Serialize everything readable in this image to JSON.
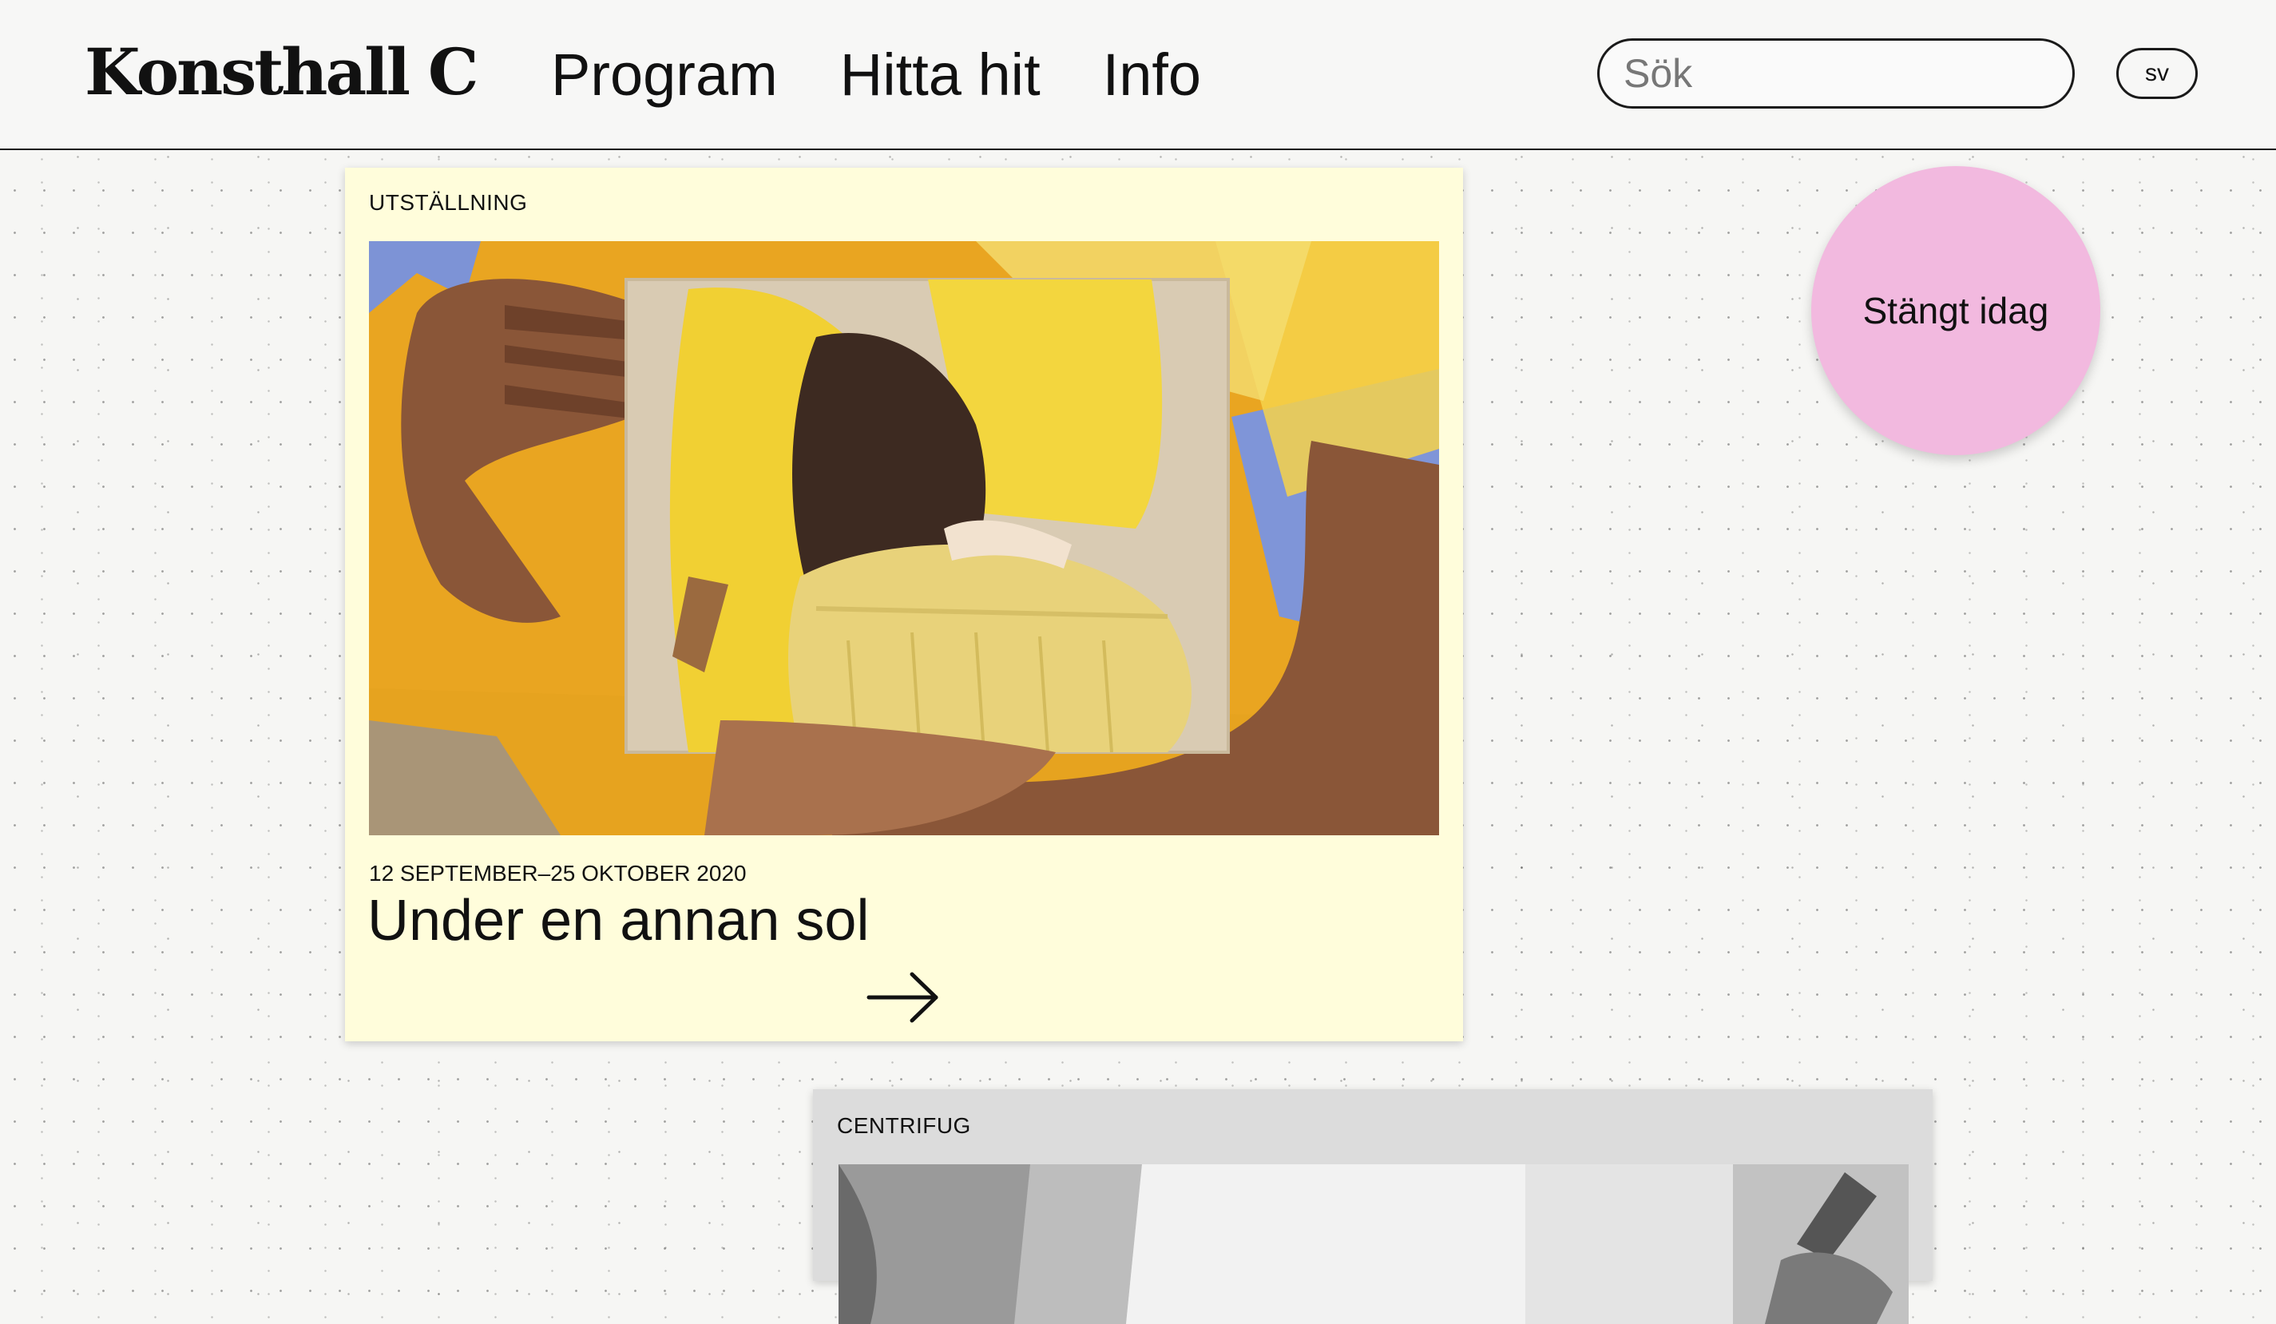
{
  "header": {
    "logo": "Konsthall C",
    "nav": [
      "Program",
      "Hitta hit",
      "Info"
    ],
    "search_placeholder": "Sök",
    "language": "sv"
  },
  "status": {
    "label": "Stängt idag",
    "color": "#f2b9df"
  },
  "cards": [
    {
      "category": "UTSTÄLLNING",
      "date": "12 SEPTEMBER–25 OKTOBER 2020",
      "title": "Under en annan sol",
      "arrow_icon": "arrow-right-icon",
      "background": "#fffddb"
    },
    {
      "category": "CENTRIFUG",
      "background": "#dcdcdc"
    }
  ]
}
